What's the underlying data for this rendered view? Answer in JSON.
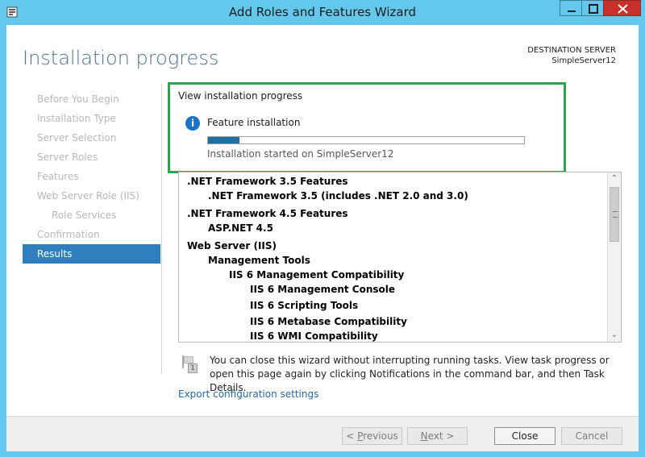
{
  "window": {
    "title": "Add Roles and Features Wizard",
    "icons": {
      "app": "server-manager-icon",
      "minimize": "minimize-icon",
      "maximize": "maximize-icon",
      "close": "close-icon"
    }
  },
  "header": {
    "title": "Installation progress",
    "destination_label": "DESTINATION SERVER",
    "destination_server": "SimpleServer12"
  },
  "nav": {
    "items": [
      {
        "label": "Before You Begin"
      },
      {
        "label": "Installation Type"
      },
      {
        "label": "Server Selection"
      },
      {
        "label": "Server Roles"
      },
      {
        "label": "Features"
      },
      {
        "label": "Web Server Role (IIS)"
      },
      {
        "label": "Role Services"
      },
      {
        "label": "Confirmation"
      },
      {
        "label": "Results"
      }
    ]
  },
  "main": {
    "section_title": "View installation progress",
    "feature_title": "Feature installation",
    "progress_fraction": 0.1,
    "install_started": "Installation started on SimpleServer12",
    "features": [
      ".NET Framework 3.5 Features",
      ".NET Framework 3.5 (includes .NET 2.0 and 3.0)",
      ".NET Framework 4.5 Features",
      "ASP.NET 4.5",
      "Web Server (IIS)",
      "Management Tools",
      "IIS 6 Management Compatibility",
      "IIS 6 Management Console",
      "IIS 6 Scripting Tools",
      "IIS 6 Metabase Compatibility",
      "IIS 6 WMI Compatibility"
    ],
    "note": "You can close this wizard without interrupting running tasks. View task progress or open this page again by clicking Notifications in the command bar, and then Task Details.",
    "export_link": "Export configuration settings"
  },
  "footer": {
    "previous_prefix": "< ",
    "previous_access": "P",
    "previous_rest": "revious",
    "next_access": "N",
    "next_rest": "ext >",
    "close_label": "Close",
    "cancel_label": "Cancel"
  },
  "colors": {
    "accent": "#2f7fbe",
    "highlight": "#2ba44a",
    "window_frame": "#63c8ec"
  }
}
